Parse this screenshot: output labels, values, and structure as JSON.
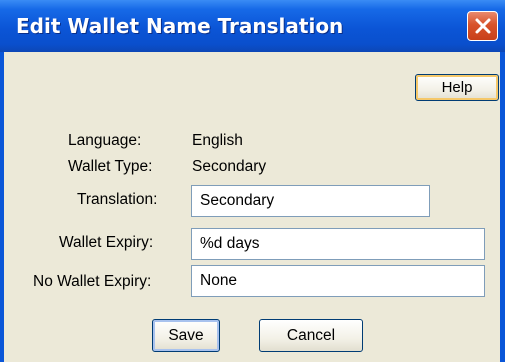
{
  "window": {
    "title": "Edit Wallet Name Translation"
  },
  "toolbar": {
    "help_label": "Help",
    "close_icon": "close-icon"
  },
  "info": {
    "language_label": "Language:",
    "language_value": "English",
    "wallet_type_label": "Wallet Type:",
    "wallet_type_value": "Secondary"
  },
  "form": {
    "translation_label": "Translation:",
    "translation_value": "Secondary",
    "wallet_expiry_label": "Wallet Expiry:",
    "wallet_expiry_value": "%d days",
    "no_wallet_expiry_label": "No Wallet Expiry:",
    "no_wallet_expiry_value": "None"
  },
  "actions": {
    "save_label": "Save",
    "cancel_label": "Cancel"
  },
  "colors": {
    "titlebar": "#0a56d8",
    "client_bg": "#ece9d8",
    "close_button": "#d8532b",
    "field_border": "#7f9db9"
  }
}
